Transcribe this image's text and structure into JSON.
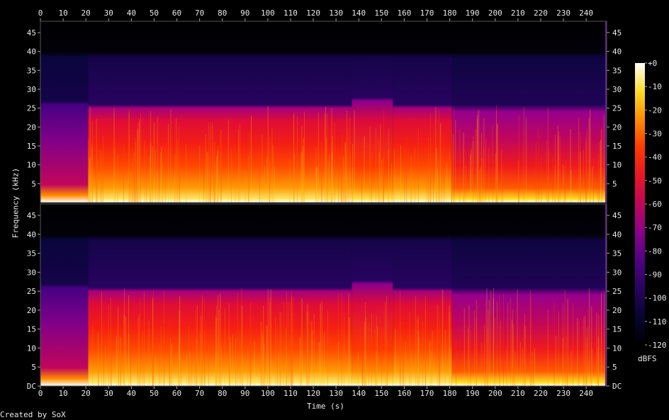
{
  "footer": {
    "credit": "Created by SoX"
  },
  "chart_data": {
    "type": "heatmap",
    "xlabel": "Time (s)",
    "ylabel": "Frequency (kHz)",
    "colorbar_label": "dBFS",
    "xlim": [
      0,
      249
    ],
    "ylim": [
      0,
      48
    ],
    "x_ticks": [
      0,
      10,
      20,
      30,
      40,
      50,
      60,
      70,
      80,
      90,
      100,
      110,
      120,
      130,
      140,
      150,
      160,
      170,
      180,
      190,
      200,
      210,
      220,
      230,
      240
    ],
    "y_ticks_top_channel": [
      "5",
      "10",
      "15",
      "20",
      "25",
      "30",
      "35",
      "40",
      "45"
    ],
    "y_ticks_bottom_channel": [
      "DC",
      "5",
      "10",
      "15",
      "20",
      "25",
      "30",
      "35",
      "40",
      "45"
    ],
    "colorbar_ticks": [
      "+0",
      "-10",
      "-20",
      "-30",
      "-40",
      "-50",
      "-60",
      "-70",
      "-80",
      "-90",
      "-100",
      "-110",
      "-120"
    ],
    "colorbar_range": [
      -120,
      0
    ],
    "channels": 2,
    "segments": [
      {
        "t": [
          0,
          21
        ],
        "cutoff_khz": 26,
        "character": "fade-in, low level"
      },
      {
        "t": [
          21,
          137
        ],
        "cutoff_khz": 26,
        "character": "loud, dense"
      },
      {
        "t": [
          137,
          155
        ],
        "cutoff_khz": 27,
        "character": "loud, extended"
      },
      {
        "t": [
          155,
          181
        ],
        "cutoff_khz": 26,
        "character": "loud, dense"
      },
      {
        "t": [
          181,
          249
        ],
        "cutoff_khz": 26,
        "character": "quieter"
      }
    ]
  },
  "colors": {
    "background": "#000000",
    "text": "#e8e8e8"
  }
}
